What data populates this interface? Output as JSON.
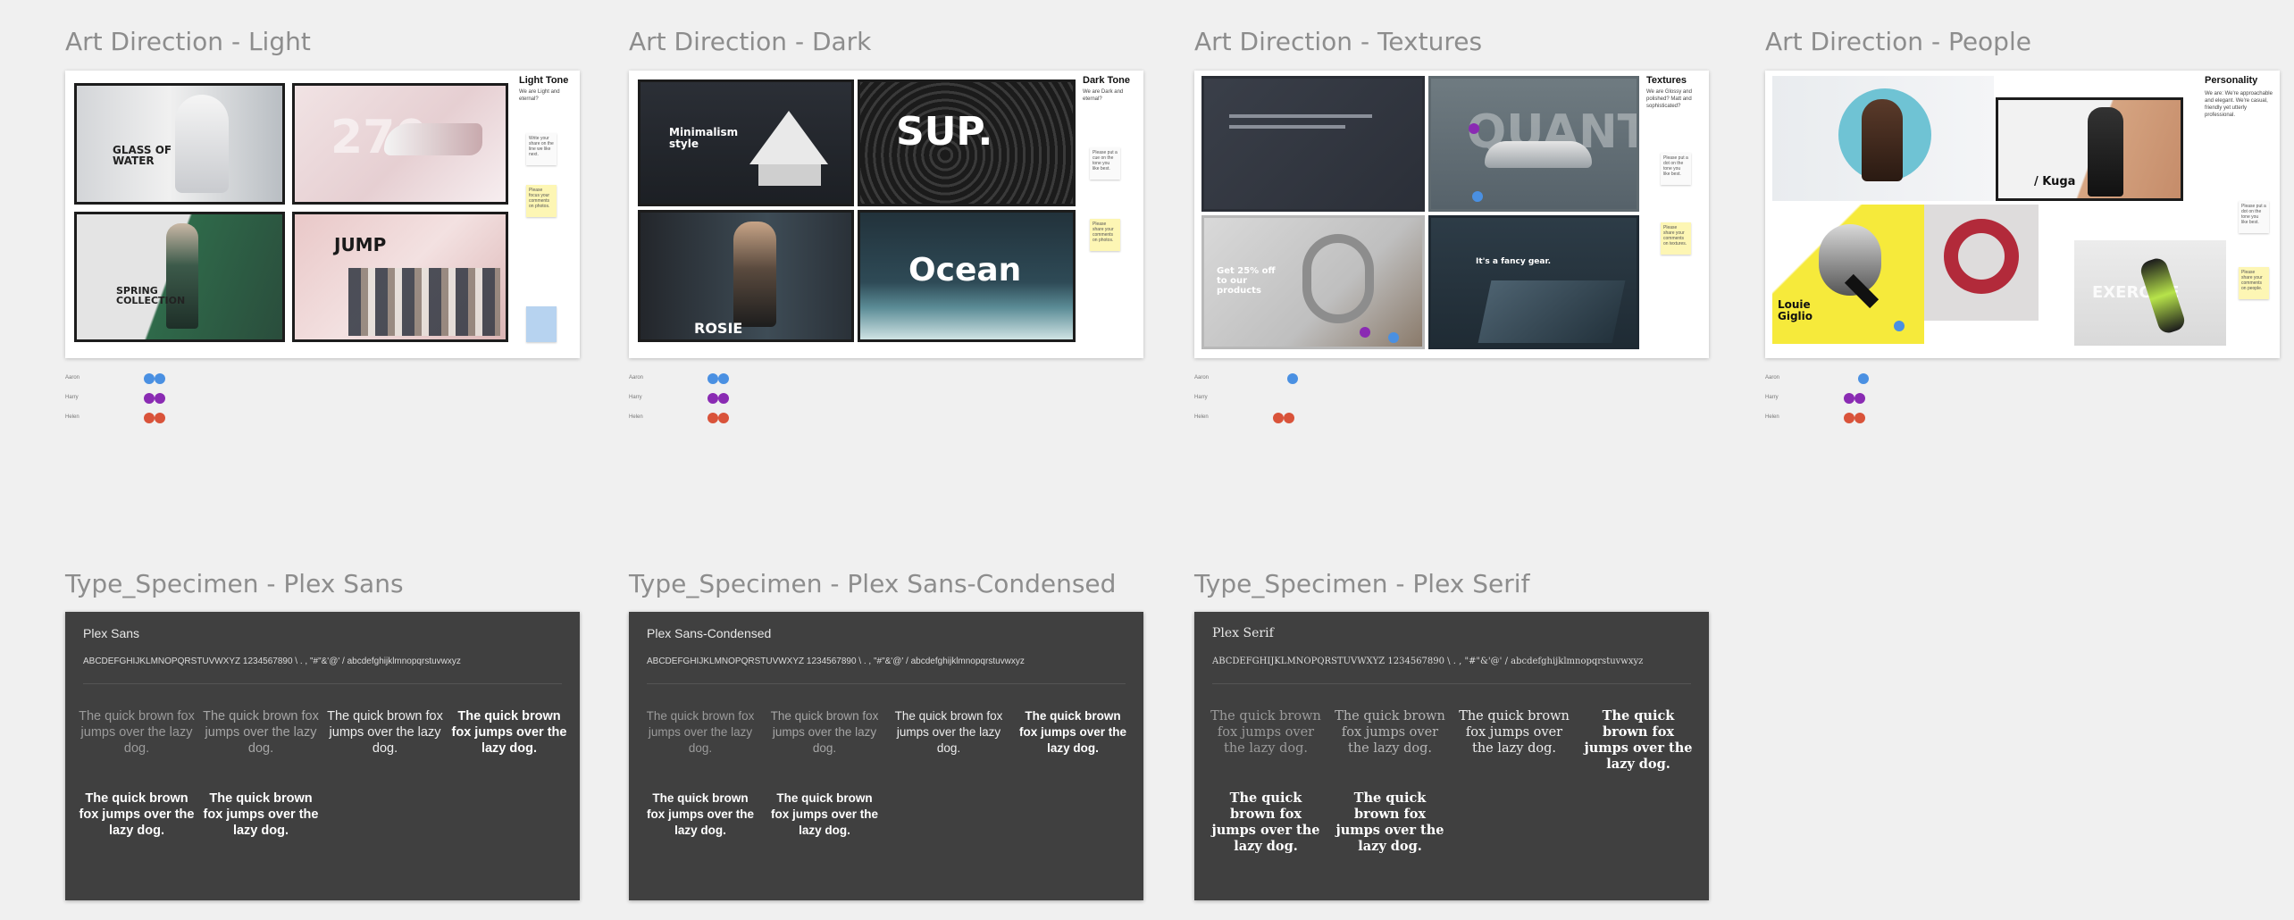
{
  "art_frames": [
    {
      "title": "Art Direction - Light",
      "side_title": "Light Tone",
      "side_text": "We are Light and eternal?",
      "tiles": [
        "GLASS OF WATER",
        "270",
        "SPRING COLLECTION",
        "JUMP"
      ],
      "notes": [
        "Write your share on the line we like next.",
        "Please focus your comments on photos."
      ],
      "legend": {
        "names": [
          "Aaron",
          "Harry",
          "Helen"
        ],
        "dot_counts": [
          2,
          2,
          2
        ]
      }
    },
    {
      "title": "Art Direction - Dark",
      "side_title": "Dark Tone",
      "side_text": "We are Dark and eternal?",
      "tiles": [
        "Minimalism style",
        "SUP.",
        "ROSIE",
        "Ocean"
      ],
      "notes": [
        "Please put a cue on the tone you like best.",
        "Please share your comments on photos."
      ],
      "legend": {
        "names": [
          "Aaron",
          "Harry",
          "Helen"
        ],
        "dot_counts": [
          2,
          2,
          2
        ]
      }
    },
    {
      "title": "Art Direction - Textures",
      "side_title": "Textures",
      "side_text": "We are Glossy and polished? Matt and sophisticated?",
      "tiles": [
        "",
        "QUANT",
        "Get 25% off to our products",
        "It's a fancy gear."
      ],
      "notes": [
        "Please put a dot on the tone you like best.",
        "Please share your comments on textures."
      ],
      "legend": {
        "names": [
          "Aaron",
          "Harry",
          "Helen"
        ],
        "dot_counts": [
          1,
          0,
          2
        ]
      }
    },
    {
      "title": "Art Direction - People",
      "side_title": "Personality",
      "side_text": "We are: We're approachable and elegant. We're casual, friendly yet utterly professional.",
      "tiles": [
        "",
        "/ Kuga",
        "Louie Giglio",
        "EXERCISE"
      ],
      "notes": [
        "Please put a dot on the tone you like best.",
        "Please share your comments on people."
      ],
      "legend": {
        "names": [
          "Aaron",
          "Harry",
          "Helen"
        ],
        "dot_counts": [
          1,
          2,
          2
        ]
      }
    }
  ],
  "type_frames": [
    {
      "title": "Type_Specimen - Plex Sans",
      "name": "Plex Sans"
    },
    {
      "title": "Type_Specimen - Plex Sans-Condensed",
      "name": "Plex Sans-Condensed"
    },
    {
      "title": "Type_Specimen - Plex Serif",
      "name": "Plex Serif"
    }
  ],
  "specimen": {
    "alphabet": "ABCDEFGHIJKLMNOPQRSTUVWXYZ  1234567890  \\ . , \"#\"&'@' /  abcdefghijklmnopqrstuvwxyz",
    "sample": "The quick brown fox jumps over the lazy dog.",
    "weights": [
      "light",
      "regular",
      "medium",
      "semibold",
      "bold",
      "heavy"
    ]
  },
  "colors": {
    "aaron": "#4a90e2",
    "harry": "#8a2bb3",
    "helen": "#d9533a",
    "note_yellow": "#fdf6b4",
    "note_blue": "#b7d3f0",
    "specimen_bg": "#404040"
  }
}
